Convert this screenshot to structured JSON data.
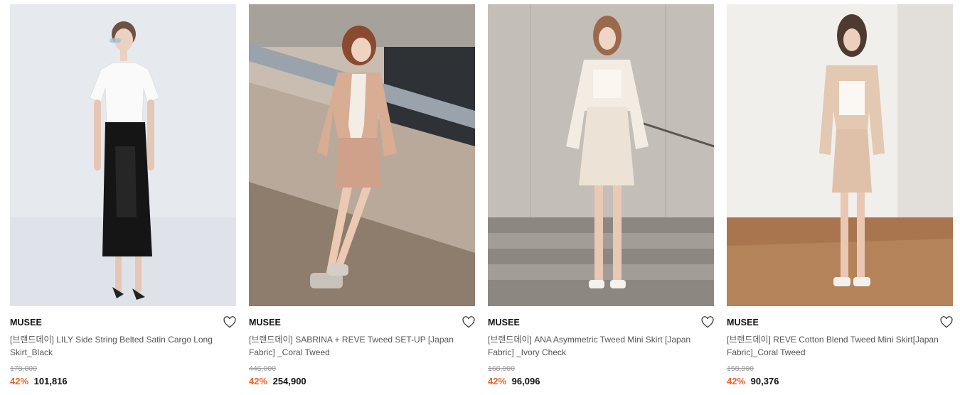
{
  "products": [
    {
      "brand": "MUSEE",
      "title": "[브랜드데이] LILY Side String Belted Satin Cargo Long Skirt_Black",
      "original_price": "178,000",
      "discount": "42%",
      "price": "101,816",
      "wishlist_icon": "heart-outline-icon"
    },
    {
      "brand": "MUSEE",
      "title": "[브랜드데이] SABRINA + REVE Tweed SET-UP [Japan Fabric] _Coral Tweed",
      "original_price": "446,000",
      "discount": "42%",
      "price": "254,900",
      "wishlist_icon": "heart-outline-icon"
    },
    {
      "brand": "MUSEE",
      "title": "[브랜드데이] ANA Asymmetric Tweed Mini Skirt [Japan Fabric] _Ivory Check",
      "original_price": "168,000",
      "discount": "42%",
      "price": "96,096",
      "wishlist_icon": "heart-outline-icon"
    },
    {
      "brand": "MUSEE",
      "title": "[브랜드데이] REVE Cotton Blend Tweed Mini Skirt[Japan Fabric]_Coral Tweed",
      "original_price": "158,000",
      "discount": "42%",
      "price": "90,376",
      "wishlist_icon": "heart-outline-icon"
    }
  ],
  "colors": {
    "discount": "#e8622a",
    "brand": "#111111",
    "title": "#555555",
    "original_price": "#9a9a9a"
  }
}
